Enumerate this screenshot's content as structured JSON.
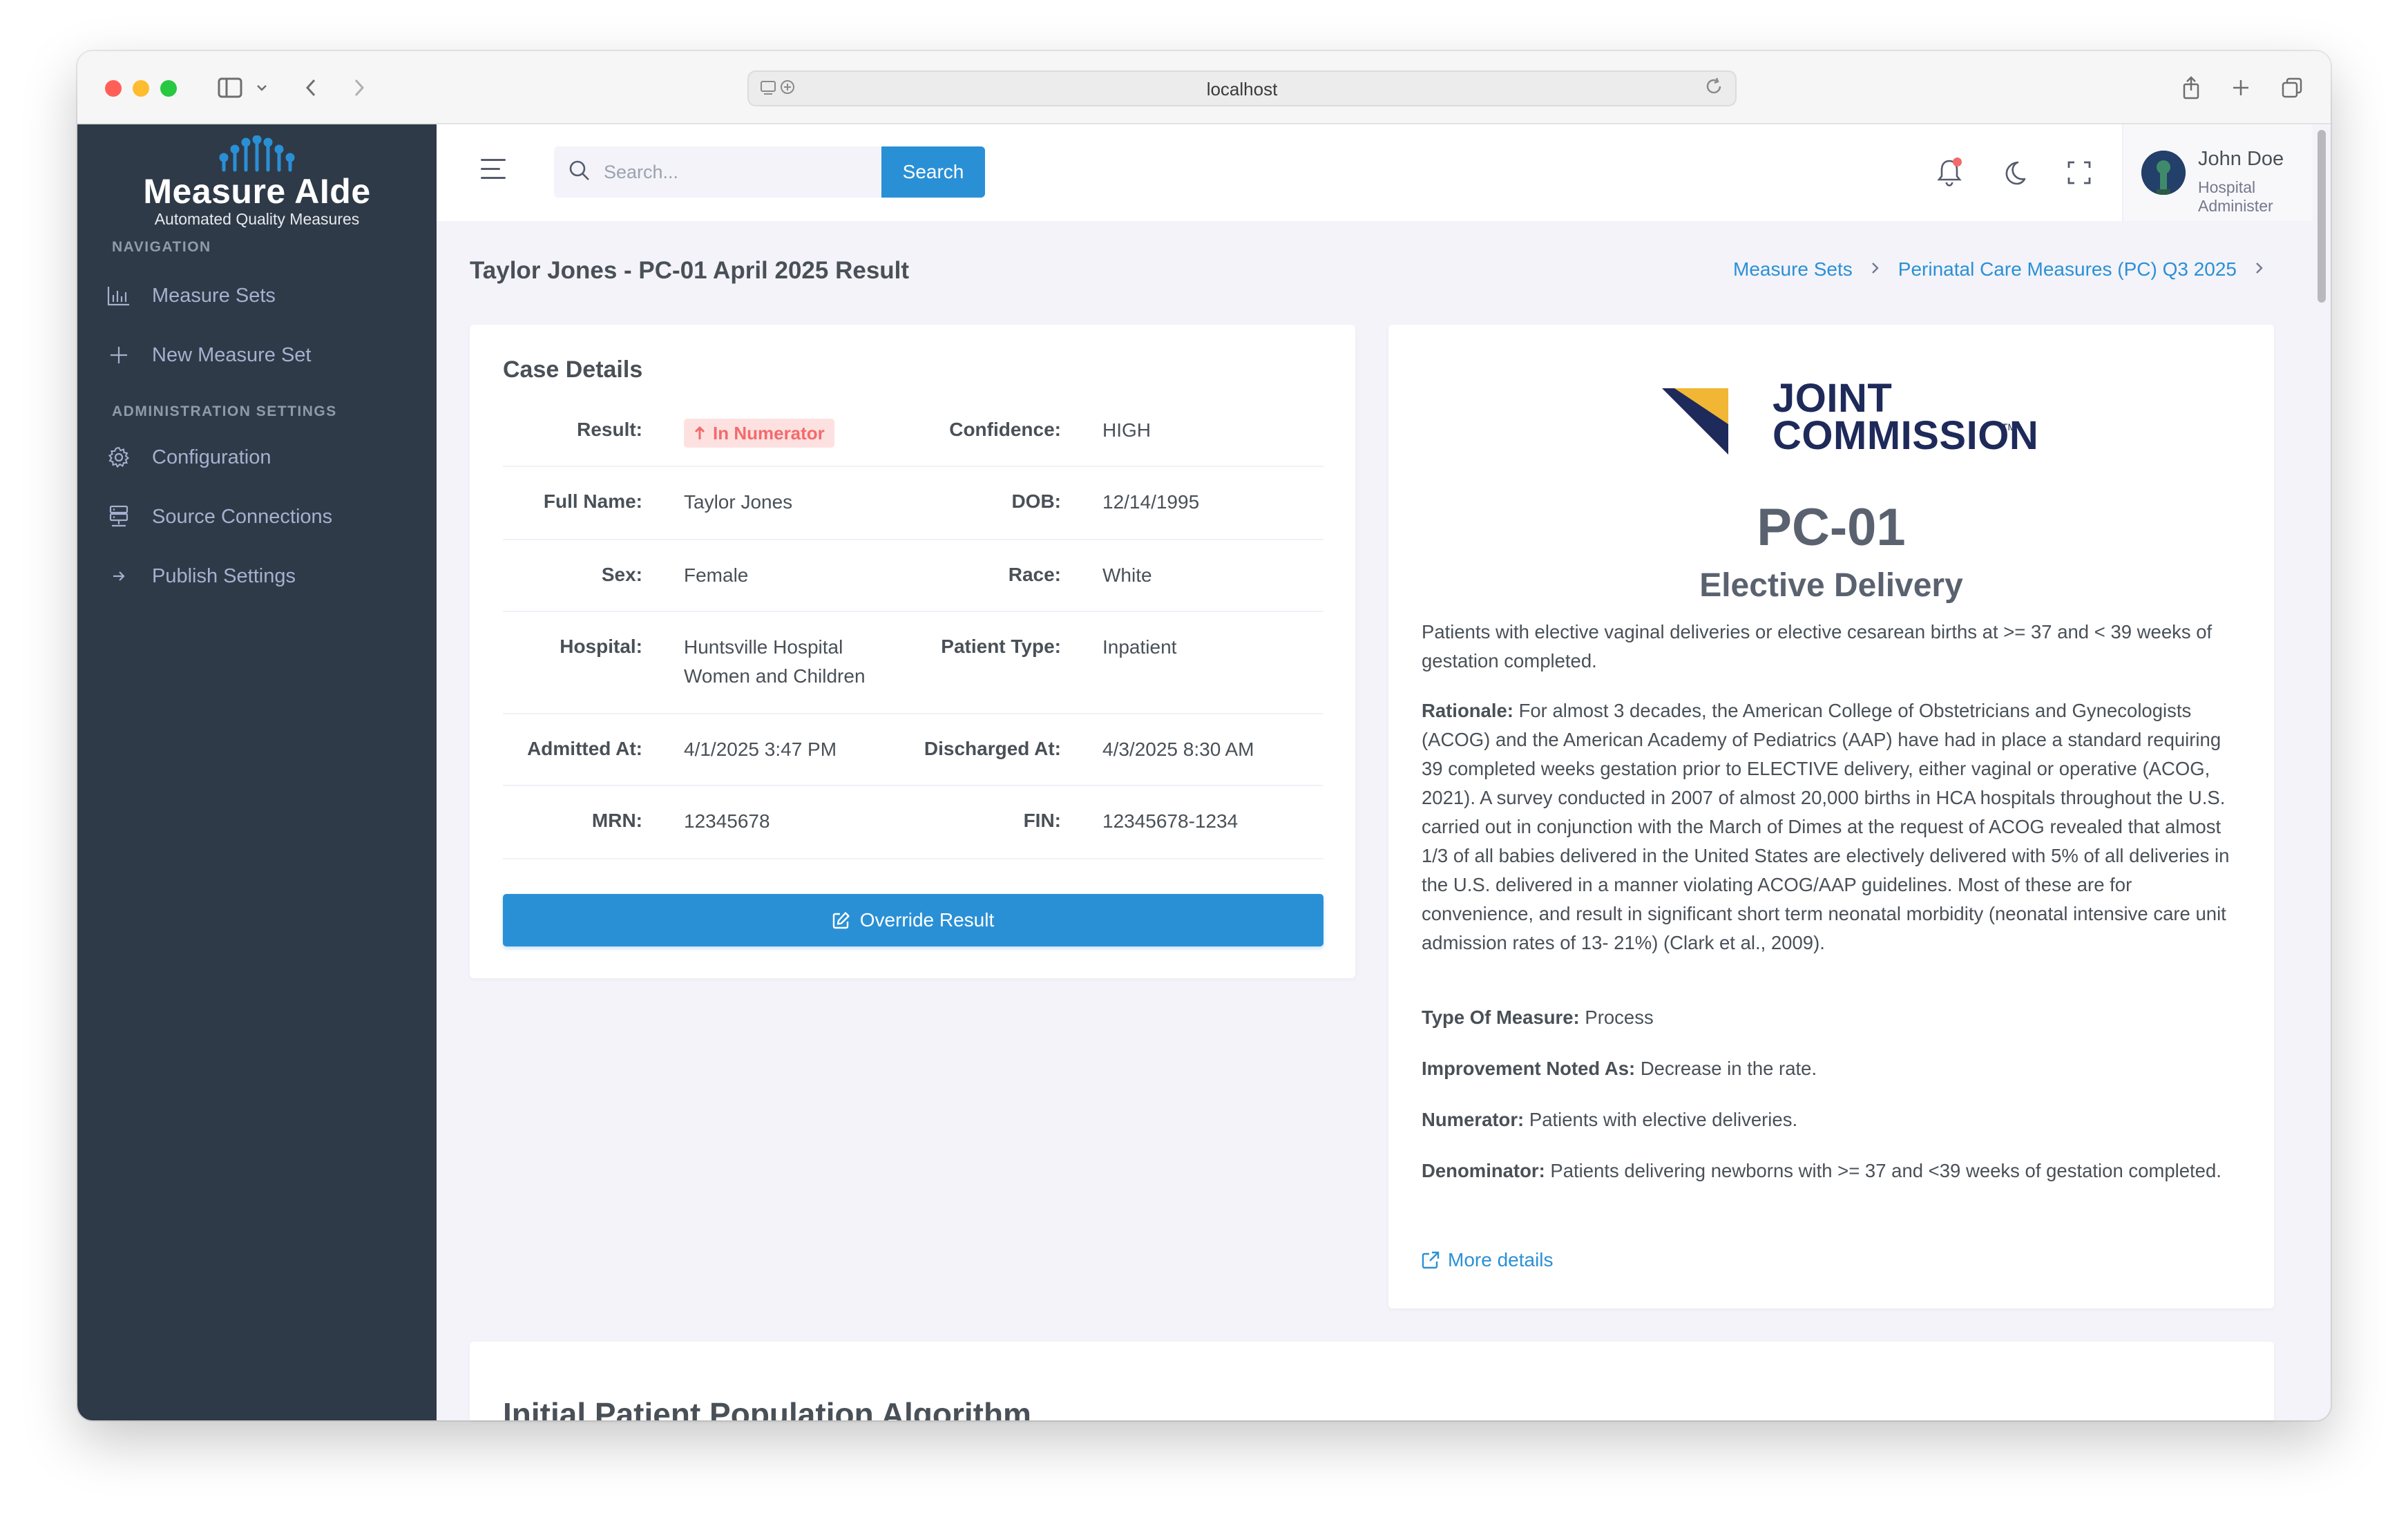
{
  "browser": {
    "url": "localhost"
  },
  "sidebar": {
    "logo_title": "Measure AIde",
    "logo_subtitle": "Automated Quality Measures",
    "sections": [
      {
        "title": "NAVIGATION",
        "items": [
          {
            "label": "Measure Sets",
            "icon": "bar-chart-icon"
          },
          {
            "label": "New Measure Set",
            "icon": "plus-icon"
          }
        ]
      },
      {
        "title": "ADMINISTRATION SETTINGS",
        "items": [
          {
            "label": "Configuration",
            "icon": "gear-icon"
          },
          {
            "label": "Source Connections",
            "icon": "server-icon"
          },
          {
            "label": "Publish Settings",
            "icon": "arrow-right-icon"
          }
        ]
      }
    ]
  },
  "topbar": {
    "search_placeholder": "Search...",
    "search_button": "Search",
    "user_name": "John Doe",
    "user_role": "Hospital Administer"
  },
  "page": {
    "title": "Taylor Jones - PC-01 April 2025 Result",
    "breadcrumb": [
      "Measure Sets",
      "Perinatal Care Measures (PC) Q3 2025"
    ]
  },
  "case_details": {
    "title": "Case Details",
    "result_label": "Result:",
    "result_value": "In Numerator",
    "confidence_label": "Confidence:",
    "confidence_value": "HIGH",
    "full_name_label": "Full Name:",
    "full_name_value": "Taylor Jones",
    "dob_label": "DOB:",
    "dob_value": "12/14/1995",
    "sex_label": "Sex:",
    "sex_value": "Female",
    "race_label": "Race:",
    "race_value": "White",
    "hospital_label": "Hospital:",
    "hospital_value_line1": "Huntsville Hospital",
    "hospital_value_line2": "Women and Children",
    "patient_type_label": "Patient Type:",
    "patient_type_value": "Inpatient",
    "admitted_label": "Admitted At:",
    "admitted_value": "4/1/2025 3:47 PM",
    "discharged_label": "Discharged At:",
    "discharged_value": "4/3/2025 8:30 AM",
    "mrn_label": "MRN:",
    "mrn_value": "12345678",
    "fin_label": "FIN:",
    "fin_value": "12345678-1234",
    "override_button": "Override Result"
  },
  "measure": {
    "org_line1": "JOINT",
    "org_line2": "COMMISSION",
    "org_tm": "TM",
    "code": "PC-01",
    "name": "Elective Delivery",
    "description": "Patients with elective vaginal deliveries or elective cesarean births at >= 37 and < 39 weeks of gestation completed.",
    "rationale_label": "Rationale:",
    "rationale_text": "For almost 3 decades, the American College of Obstetricians and Gynecologists (ACOG) and the American Academy of Pediatrics (AAP) have had in place a standard requiring 39 completed weeks gestation prior to ELECTIVE delivery, either vaginal or operative (ACOG, 2021). A survey conducted in 2007 of almost 20,000 births in HCA hospitals throughout the U.S. carried out in conjunction with the March of Dimes at the request of ACOG revealed that almost 1/3 of all babies delivered in the United States are electively delivered with 5% of all deliveries in the U.S. delivered in a manner violating ACOG/AAP guidelines. Most of these are for convenience, and result in significant short term neonatal morbidity (neonatal intensive care unit admission rates of 13- 21%) (Clark et al., 2009).",
    "type_label": "Type Of Measure:",
    "type_value": "Process",
    "improvement_label": "Improvement Noted As:",
    "improvement_value": "Decrease in the rate.",
    "numerator_label": "Numerator:",
    "numerator_value": "Patients with elective deliveries.",
    "denominator_label": "Denominator:",
    "denominator_value": "Patients delivering newborns with >= 37 and <39 weeks of gestation completed.",
    "more_details": "More details"
  },
  "algorithm": {
    "title": "Initial Patient Population Algorithm"
  },
  "colors": {
    "primary": "#2a90d6",
    "sidebar": "#2f3a48",
    "danger": "#f46a6a",
    "jc_navy": "#1e2a5a",
    "jc_gold": "#f2b635"
  }
}
